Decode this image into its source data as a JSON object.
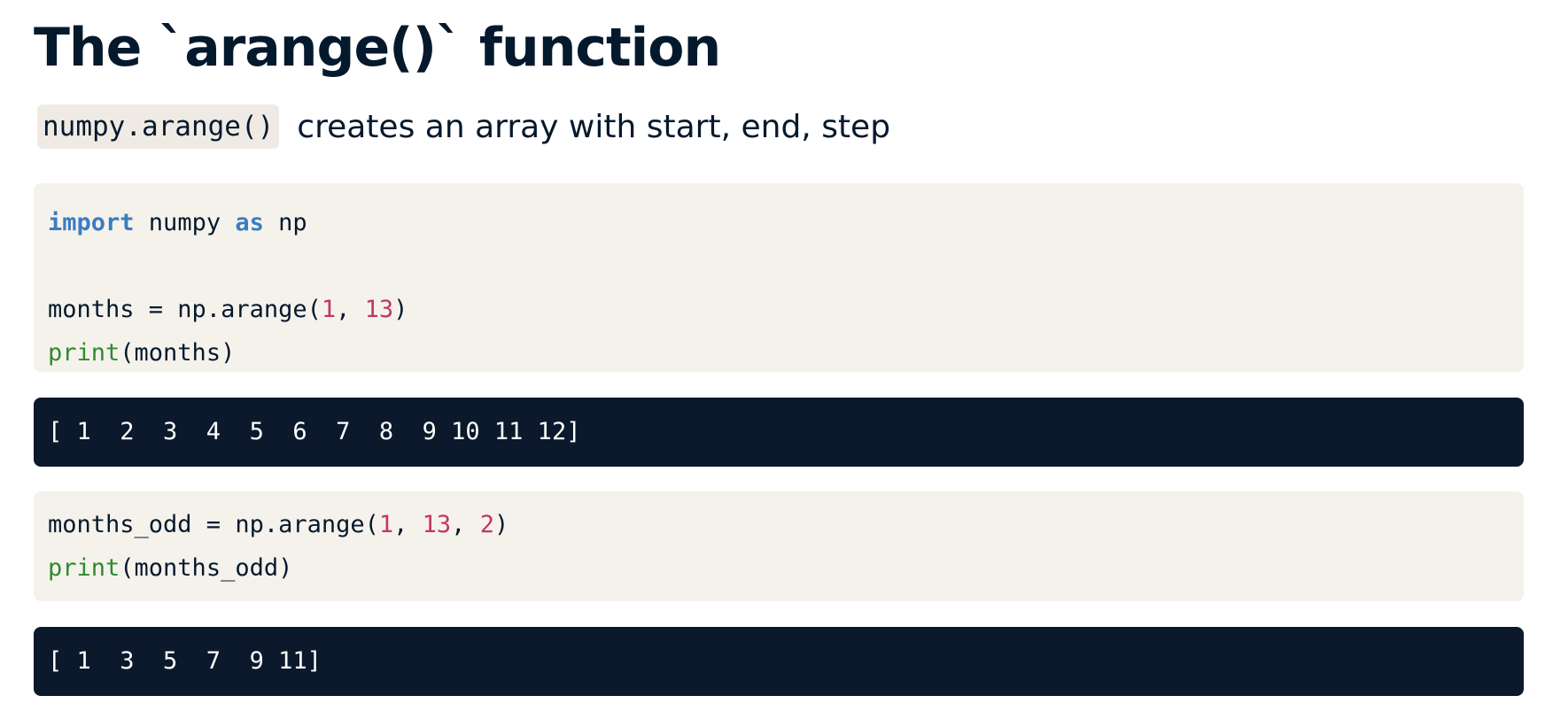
{
  "title": "The `arange()` function",
  "subtitle": {
    "code": "numpy.arange()",
    "text": "creates an array with start, end, step"
  },
  "code_block_1": {
    "line1": {
      "kw1": "import",
      "mid": " numpy ",
      "kw2": "as",
      "end": " np"
    },
    "line2": {
      "pre": "months = np.arange(",
      "n1": "1",
      "sep": ", ",
      "n2": "13",
      "post": ")"
    },
    "line3": {
      "fn": "print",
      "rest": "(months)"
    }
  },
  "output_1": "[ 1  2  3  4  5  6  7  8  9 10 11 12]",
  "code_block_2": {
    "line1": {
      "pre": "months_odd = np.arange(",
      "n1": "1",
      "sep1": ", ",
      "n2": "13",
      "sep2": ", ",
      "n3": "2",
      "post": ")"
    },
    "line2": {
      "fn": "print",
      "rest": "(months_odd)"
    }
  },
  "output_2": "[ 1  3  5  7  9 11]",
  "colors": {
    "text": "#05192d",
    "keyword": "#3b7dbf",
    "number": "#c2385c",
    "builtin": "#2f8a2f",
    "code_bg": "#f5f2ec",
    "output_bg": "#0c192c"
  }
}
